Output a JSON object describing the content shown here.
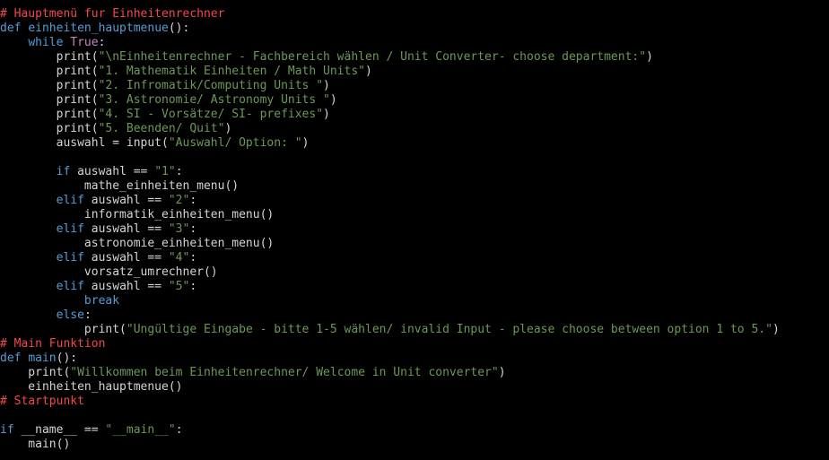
{
  "colors": {
    "background": "#000000",
    "default": "#d4d4d4",
    "keyword": "#569cd6",
    "string": "#6a9955",
    "comment": "#f44747",
    "boolean": "#c586c0",
    "function_name": "#569cd6"
  },
  "lines": [
    [
      [
        "comment",
        "# Hauptmenü fur Einheitenrechner"
      ]
    ],
    [
      [
        "keyword",
        "def"
      ],
      [
        "default",
        " "
      ],
      [
        "function_name",
        "einheiten_hauptmenue"
      ],
      [
        "default",
        "():"
      ]
    ],
    [
      [
        "default",
        "    "
      ],
      [
        "keyword",
        "while"
      ],
      [
        "default",
        " "
      ],
      [
        "boolean",
        "True"
      ],
      [
        "default",
        ":"
      ]
    ],
    [
      [
        "default",
        "        print("
      ],
      [
        "string",
        "\"\\nEinheitenrechner - Fachbereich wählen / Unit Converter- choose department:\""
      ],
      [
        "default",
        ")"
      ]
    ],
    [
      [
        "default",
        "        print("
      ],
      [
        "string",
        "\"1. Mathematik Einheiten / Math Units\""
      ],
      [
        "default",
        ")"
      ]
    ],
    [
      [
        "default",
        "        print("
      ],
      [
        "string",
        "\"2. Infromatik/Computing Units \""
      ],
      [
        "default",
        ")"
      ]
    ],
    [
      [
        "default",
        "        print("
      ],
      [
        "string",
        "\"3. Astronomie/ Astronomy Units \""
      ],
      [
        "default",
        ")"
      ]
    ],
    [
      [
        "default",
        "        print("
      ],
      [
        "string",
        "\"4. SI - Vorsätze/ SI- prefixes\""
      ],
      [
        "default",
        ")"
      ]
    ],
    [
      [
        "default",
        "        print("
      ],
      [
        "string",
        "\"5. Beenden/ Quit\""
      ],
      [
        "default",
        ")"
      ]
    ],
    [
      [
        "default",
        "        auswahl = input("
      ],
      [
        "string",
        "\"Auswahl/ Option: \""
      ],
      [
        "default",
        ")"
      ]
    ],
    [
      [
        "default",
        ""
      ]
    ],
    [
      [
        "default",
        "        "
      ],
      [
        "keyword",
        "if"
      ],
      [
        "default",
        " auswahl == "
      ],
      [
        "string",
        "\"1\""
      ],
      [
        "default",
        ":"
      ]
    ],
    [
      [
        "default",
        "            mathe_einheiten_menu()"
      ]
    ],
    [
      [
        "default",
        "        "
      ],
      [
        "keyword",
        "elif"
      ],
      [
        "default",
        " auswahl == "
      ],
      [
        "string",
        "\"2\""
      ],
      [
        "default",
        ":"
      ]
    ],
    [
      [
        "default",
        "            informatik_einheiten_menu()"
      ]
    ],
    [
      [
        "default",
        "        "
      ],
      [
        "keyword",
        "elif"
      ],
      [
        "default",
        " auswahl == "
      ],
      [
        "string",
        "\"3\""
      ],
      [
        "default",
        ":"
      ]
    ],
    [
      [
        "default",
        "            astronomie_einheiten_menu()"
      ]
    ],
    [
      [
        "default",
        "        "
      ],
      [
        "keyword",
        "elif"
      ],
      [
        "default",
        " auswahl == "
      ],
      [
        "string",
        "\"4\""
      ],
      [
        "default",
        ":"
      ]
    ],
    [
      [
        "default",
        "            vorsatz_umrechner()"
      ]
    ],
    [
      [
        "default",
        "        "
      ],
      [
        "keyword",
        "elif"
      ],
      [
        "default",
        " auswahl == "
      ],
      [
        "string",
        "\"5\""
      ],
      [
        "default",
        ":"
      ]
    ],
    [
      [
        "default",
        "            "
      ],
      [
        "keyword",
        "break"
      ]
    ],
    [
      [
        "default",
        "        "
      ],
      [
        "keyword",
        "else"
      ],
      [
        "default",
        ":"
      ]
    ],
    [
      [
        "default",
        "            print("
      ],
      [
        "string",
        "\"Ungültige Eingabe - bitte 1-5 wählen/ invalid Input - please choose between option 1 to 5.\""
      ],
      [
        "default",
        ")"
      ]
    ],
    [
      [
        "comment",
        "# Main Funktion"
      ]
    ],
    [
      [
        "keyword",
        "def"
      ],
      [
        "default",
        " "
      ],
      [
        "function_name",
        "main"
      ],
      [
        "default",
        "():"
      ]
    ],
    [
      [
        "default",
        "    print("
      ],
      [
        "string",
        "\"Willkommen beim Einheitenrechner/ Welcome in Unit converter\""
      ],
      [
        "default",
        ")"
      ]
    ],
    [
      [
        "default",
        "    einheiten_hauptmenue()"
      ]
    ],
    [
      [
        "comment",
        "# Startpunkt"
      ]
    ],
    [
      [
        "default",
        ""
      ]
    ],
    [
      [
        "keyword",
        "if"
      ],
      [
        "default",
        " __name__ == "
      ],
      [
        "string",
        "\"__main__\""
      ],
      [
        "default",
        ":"
      ]
    ],
    [
      [
        "default",
        "    main()"
      ]
    ]
  ]
}
